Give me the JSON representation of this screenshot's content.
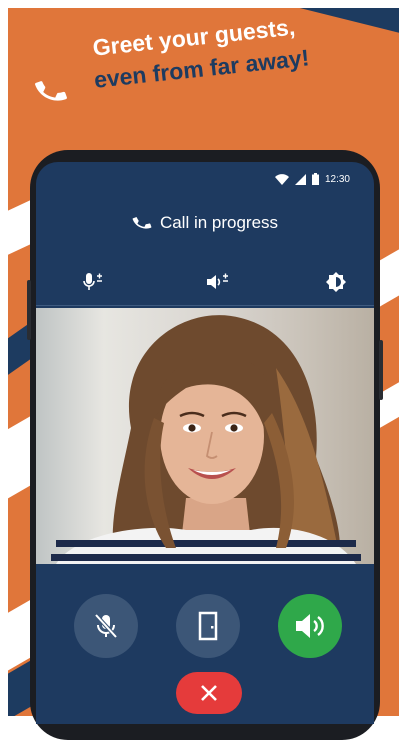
{
  "promo": {
    "headline_line1": "Greet your guests,",
    "headline_line2": "even from far away!",
    "background_color": "#e0763a",
    "accent_color": "#1d3b60"
  },
  "status_bar": {
    "time": "12:30",
    "icons": [
      "wifi-icon",
      "signal-icon",
      "battery-icon"
    ]
  },
  "call": {
    "title": "Call in progress",
    "title_icon": "phone-icon"
  },
  "controls": {
    "icons": [
      "microphone-volume-icon",
      "speaker-volume-icon",
      "brightness-icon"
    ]
  },
  "actions": {
    "mute_icon": "microphone-off-icon",
    "door_icon": "door-icon",
    "speaker_icon": "speaker-icon",
    "hangup_icon": "close-icon",
    "speaker_color": "#2fa84a",
    "hangup_color": "#e53b3b"
  }
}
